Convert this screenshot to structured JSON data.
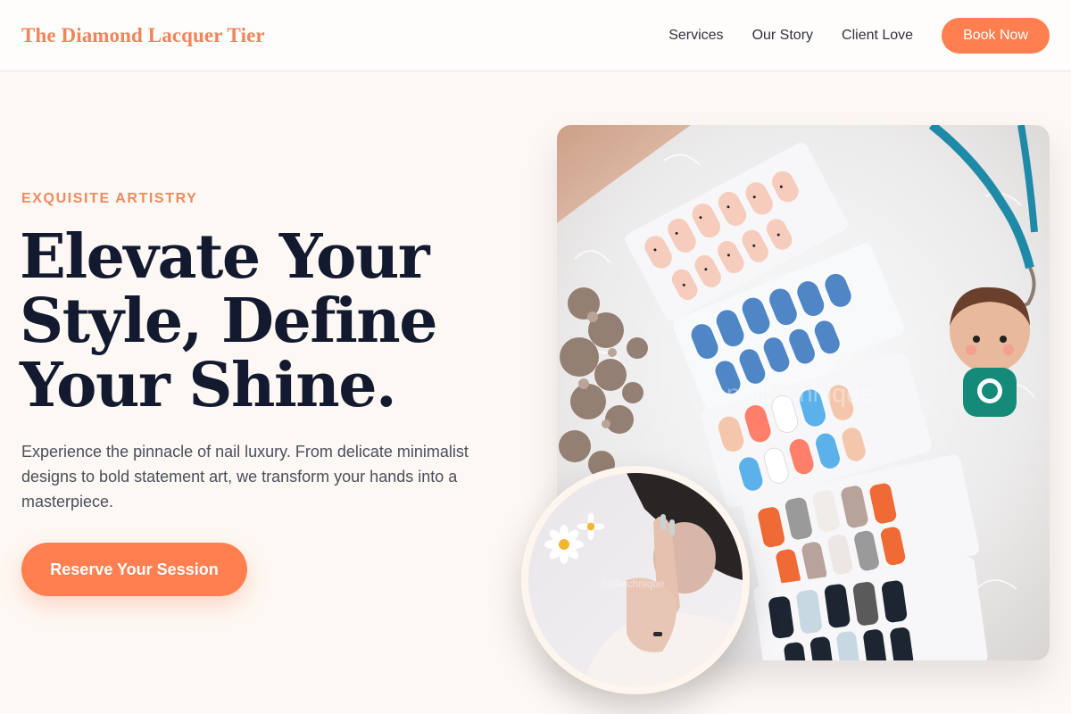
{
  "header": {
    "brand": "The Diamond Lacquer Tier",
    "nav": [
      "Services",
      "Our Story",
      "Client Love"
    ],
    "cta_label": "Book Now"
  },
  "hero": {
    "eyebrow": "EXQUISITE ARTISTRY",
    "headline_lines": [
      "Elevate Your",
      "Style, Define",
      "Your Shine."
    ],
    "lead": "Experience the pinnacle of nail luxury. From delicate minimalist designs to bold statement art, we transform your hands into a masterpiece.",
    "cta_label": "Reserve Your Session"
  },
  "images": {
    "main": "press-on nail sets photo",
    "inset": "hands with rings photo",
    "watermark": "nailtechnique"
  },
  "colors": {
    "accent": "#ff7f50",
    "brand": "#f0845a",
    "headline": "#131a30",
    "background": "#fdf8f4"
  }
}
